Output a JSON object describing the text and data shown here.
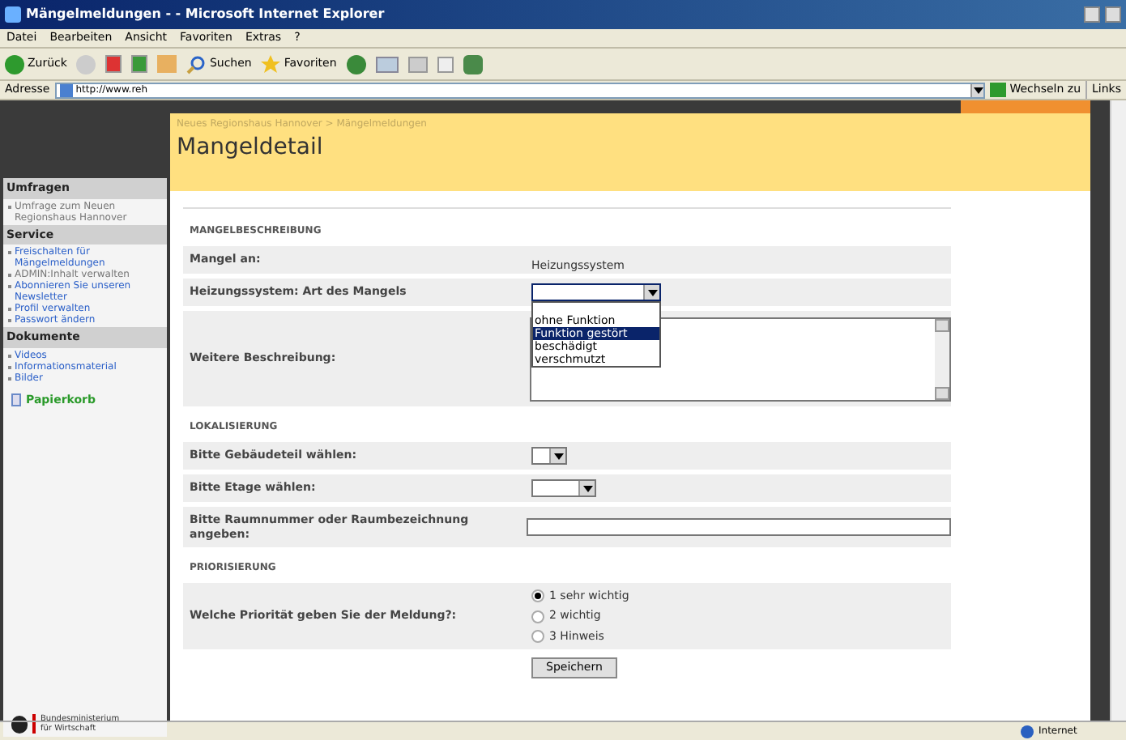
{
  "window": {
    "title": "Mängelmeldungen - - Microsoft Internet Explorer"
  },
  "menu": [
    "Datei",
    "Bearbeiten",
    "Ansicht",
    "Favoriten",
    "Extras",
    "?"
  ],
  "toolbar": {
    "back": "Zurück",
    "search": "Suchen",
    "favorites": "Favoriten"
  },
  "address": {
    "label": "Adresse",
    "url": "http://www.reh",
    "go": "Wechseln zu",
    "links": "Links"
  },
  "sidebar": [
    {
      "title": "Umfragen",
      "items": [
        {
          "label": "Umfrage zum Neuen Regionshaus Hannover",
          "kind": "plain"
        }
      ]
    },
    {
      "title": "Service",
      "items": [
        {
          "label": "Freischalten für Mängelmeldungen",
          "kind": "link"
        },
        {
          "label": "ADMIN:Inhalt verwalten",
          "kind": "plain"
        },
        {
          "label": "Abonnieren Sie unseren Newsletter",
          "kind": "link"
        },
        {
          "label": "Profil verwalten",
          "kind": "link"
        },
        {
          "label": "Passwort ändern",
          "kind": "link"
        }
      ]
    },
    {
      "title": "Dokumente",
      "items": [
        {
          "label": "Videos",
          "kind": "link"
        },
        {
          "label": "Informationsmaterial",
          "kind": "link"
        },
        {
          "label": "Bilder",
          "kind": "link"
        }
      ]
    }
  ],
  "trash": "Papierkorb",
  "logo": "Bundesministerium für Wirtschaft",
  "breadcrumb": "Neues Regionshaus Hannover > Mängelmeldungen",
  "page_title": "Mangeldetail",
  "sections": [
    {
      "heading": "MANGELBESCHREIBUNG",
      "rows": [
        {
          "kind": "text",
          "label": "Mangel an:",
          "value": "Heizungssystem"
        },
        {
          "kind": "dropdown",
          "label": "Heizungssystem: Art des Mangels",
          "expanded": true,
          "options": [
            {
              "label": "ohne Funktion",
              "selected": false
            },
            {
              "label": "Funktion gestört",
              "selected": true
            },
            {
              "label": "beschädigt",
              "selected": false
            },
            {
              "label": "verschmutzt",
              "selected": false
            }
          ]
        },
        {
          "kind": "textarea",
          "label": "Weitere Beschreibung:"
        }
      ]
    },
    {
      "heading": "LOKALISIERUNG",
      "rows": [
        {
          "kind": "select_small",
          "label": "Bitte Gebäudeteil wählen:"
        },
        {
          "kind": "select",
          "label": "Bitte Etage wählen:"
        },
        {
          "kind": "input",
          "label": "Bitte Raumnummer oder Raumbezeichnung angeben:"
        }
      ]
    },
    {
      "heading": "PRIORISIERUNG",
      "rows": [
        {
          "kind": "radio",
          "label": "Welche Priorität geben Sie der Meldung?:",
          "options": [
            {
              "label": "1 sehr wichtig",
              "selected": true
            },
            {
              "label": "2 wichtig",
              "selected": false
            },
            {
              "label": "3 Hinweis",
              "selected": false
            }
          ]
        }
      ]
    }
  ],
  "save_button": "Speichern",
  "status": {
    "zone": "Internet"
  }
}
